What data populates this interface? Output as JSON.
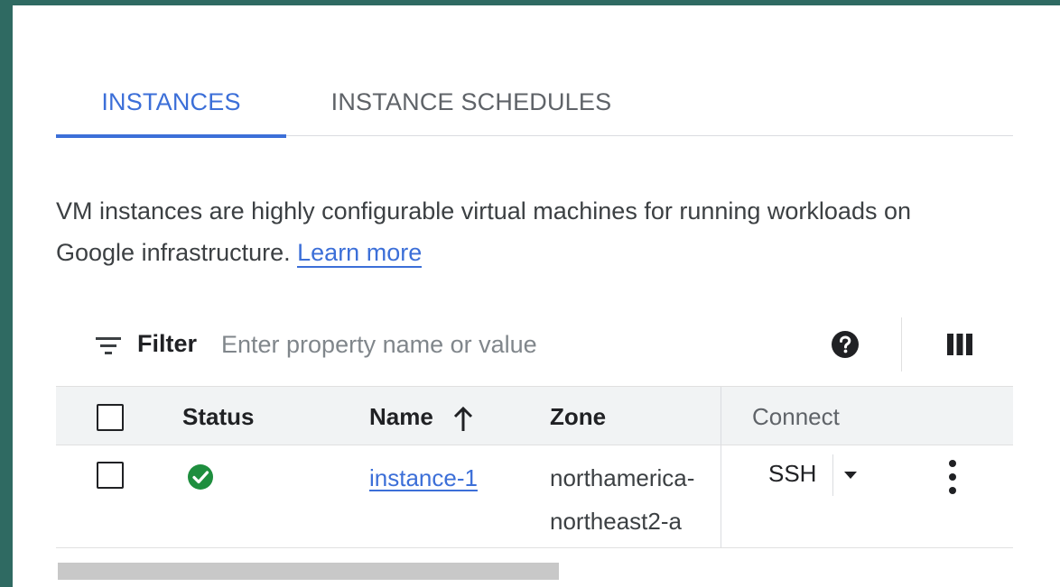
{
  "tabs": [
    {
      "label": "INSTANCES",
      "active": true
    },
    {
      "label": "INSTANCE SCHEDULES",
      "active": false
    }
  ],
  "description": {
    "line1": "VM instances are highly configurable virtual machines for running workloads on",
    "line2": "Google infrastructure.",
    "learn_more": "Learn more"
  },
  "filter": {
    "label": "Filter",
    "placeholder": "Enter property name or value",
    "icons": [
      "filter-icon",
      "help-icon",
      "column-display-icon"
    ]
  },
  "table": {
    "columns": {
      "status": "Status",
      "name": "Name",
      "zone": "Zone",
      "connect": "Connect"
    },
    "sort": {
      "column": "name",
      "direction": "ascending",
      "icon": "arrow-up-icon"
    },
    "rows": [
      {
        "status": "running",
        "status_icon": "check-circle-icon",
        "name": "instance-1",
        "zone": "northamerica-northeast2-a",
        "connect": "SSH"
      }
    ]
  },
  "colors": {
    "accent": "#3c6fd8",
    "status_ok": "#1e8e3e",
    "backdrop": "#2f6a62"
  }
}
